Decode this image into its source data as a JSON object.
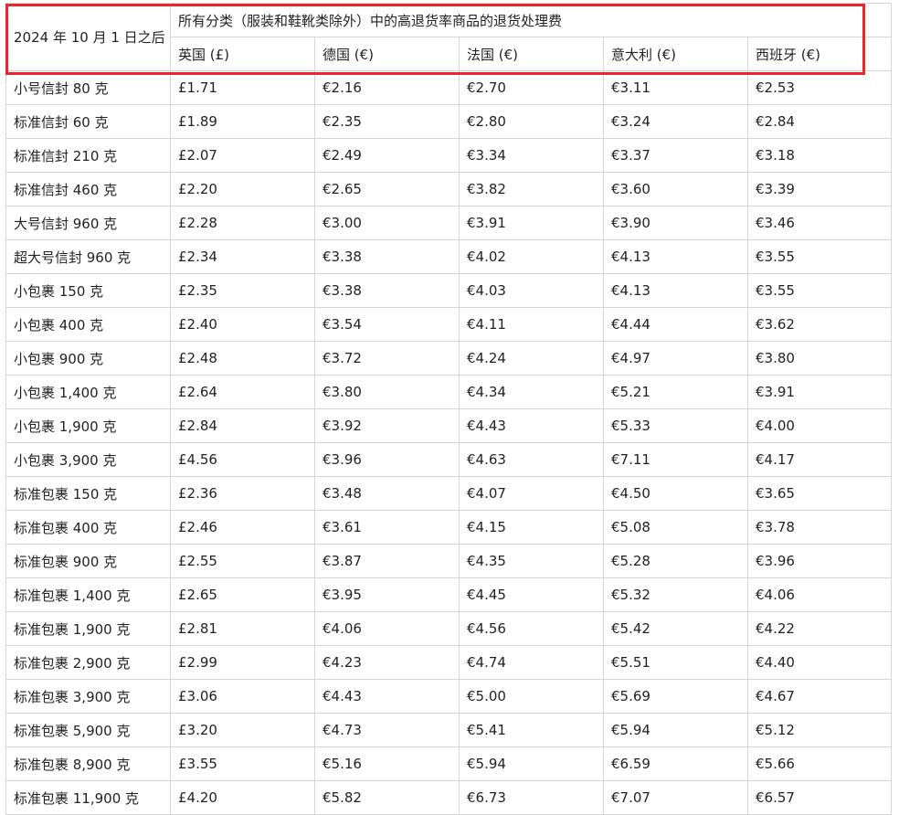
{
  "corner_label": "2024 年 10 月 1 日之后",
  "group_header": "所有分类（服装和鞋靴类除外）中的高退货率商品的退货处理费",
  "columns": [
    "英国 (£)",
    "德国 (€)",
    "法国 (€)",
    "意大利 (€)",
    "西班牙 (€)"
  ],
  "highlight_color": "#e8262c",
  "rows": [
    {
      "tier": "小号信封 80 克",
      "uk": "£1.71",
      "de": "€2.16",
      "fr": "€2.70",
      "it": "€3.11",
      "es": "€2.53"
    },
    {
      "tier": "标准信封 60 克",
      "uk": "£1.89",
      "de": "€2.35",
      "fr": "€2.80",
      "it": "€3.24",
      "es": "€2.84"
    },
    {
      "tier": "标准信封 210 克",
      "uk": "£2.07",
      "de": "€2.49",
      "fr": "€3.34",
      "it": "€3.37",
      "es": "€3.18"
    },
    {
      "tier": "标准信封 460 克",
      "uk": "£2.20",
      "de": "€2.65",
      "fr": "€3.82",
      "it": "€3.60",
      "es": "€3.39"
    },
    {
      "tier": "大号信封 960 克",
      "uk": "£2.28",
      "de": "€3.00",
      "fr": "€3.91",
      "it": "€3.90",
      "es": "€3.46"
    },
    {
      "tier": "超大号信封 960 克",
      "uk": "£2.34",
      "de": "€3.38",
      "fr": "€4.02",
      "it": "€4.13",
      "es": "€3.55"
    },
    {
      "tier": "小包裹 150 克",
      "uk": "£2.35",
      "de": "€3.38",
      "fr": "€4.03",
      "it": "€4.13",
      "es": "€3.55"
    },
    {
      "tier": "小包裹 400 克",
      "uk": "£2.40",
      "de": "€3.54",
      "fr": "€4.11",
      "it": "€4.44",
      "es": "€3.62"
    },
    {
      "tier": "小包裹 900 克",
      "uk": "£2.48",
      "de": "€3.72",
      "fr": "€4.24",
      "it": "€4.97",
      "es": "€3.80"
    },
    {
      "tier": "小包裹 1,400 克",
      "uk": "£2.64",
      "de": "€3.80",
      "fr": "€4.34",
      "it": "€5.21",
      "es": "€3.91"
    },
    {
      "tier": "小包裹 1,900 克",
      "uk": "£2.84",
      "de": "€3.92",
      "fr": "€4.43",
      "it": "€5.33",
      "es": "€4.00"
    },
    {
      "tier": "小包裹 3,900 克",
      "uk": "£4.56",
      "de": "€3.96",
      "fr": "€4.63",
      "it": "€7.11",
      "es": "€4.17"
    },
    {
      "tier": "标准包裹 150 克",
      "uk": "£2.36",
      "de": "€3.48",
      "fr": "€4.07",
      "it": "€4.50",
      "es": "€3.65"
    },
    {
      "tier": "标准包裹 400 克",
      "uk": "£2.46",
      "de": "€3.61",
      "fr": "€4.15",
      "it": "€5.08",
      "es": "€3.78"
    },
    {
      "tier": "标准包裹 900 克",
      "uk": "£2.55",
      "de": "€3.87",
      "fr": "€4.35",
      "it": "€5.28",
      "es": "€3.96"
    },
    {
      "tier": "标准包裹 1,400 克",
      "uk": "£2.65",
      "de": "€3.95",
      "fr": "€4.45",
      "it": "€5.32",
      "es": "€4.06"
    },
    {
      "tier": "标准包裹 1,900 克",
      "uk": "£2.81",
      "de": "€4.06",
      "fr": "€4.56",
      "it": "€5.42",
      "es": "€4.22"
    },
    {
      "tier": "标准包裹 2,900 克",
      "uk": "£2.99",
      "de": "€4.23",
      "fr": "€4.74",
      "it": "€5.51",
      "es": "€4.40"
    },
    {
      "tier": "标准包裹 3,900 克",
      "uk": "£3.06",
      "de": "€4.43",
      "fr": "€5.00",
      "it": "€5.69",
      "es": "€4.67"
    },
    {
      "tier": "标准包裹 5,900 克",
      "uk": "£3.20",
      "de": "€4.73",
      "fr": "€5.41",
      "it": "€5.94",
      "es": "€5.12"
    },
    {
      "tier": "标准包裹 8,900 克",
      "uk": "£3.55",
      "de": "€5.16",
      "fr": "€5.94",
      "it": "€6.59",
      "es": "€5.66"
    },
    {
      "tier": "标准包裹 11,900 克",
      "uk": "£4.20",
      "de": "€5.82",
      "fr": "€6.73",
      "it": "€7.07",
      "es": "€6.57"
    }
  ]
}
